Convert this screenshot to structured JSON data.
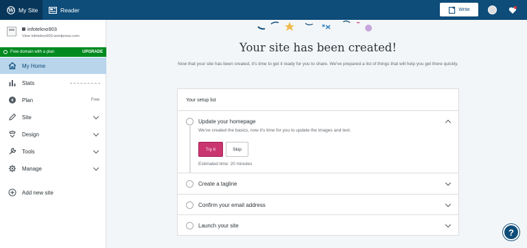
{
  "masterbar": {
    "my_site": "My Site",
    "reader": "Reader",
    "write": "Write"
  },
  "sidebar": {
    "site_name": "infotekno903",
    "site_url": "View infotekno903.wordpress.com",
    "upgrade_text": "Free domain with a plan",
    "upgrade_label": "UPGRADE",
    "items": [
      {
        "label": "My Home",
        "icon": "home-icon"
      },
      {
        "label": "Stats",
        "icon": "stats-icon"
      },
      {
        "label": "Plan",
        "icon": "plan-icon",
        "badge": "Free"
      },
      {
        "label": "Site",
        "icon": "pencil-icon"
      },
      {
        "label": "Design",
        "icon": "design-icon"
      },
      {
        "label": "Tools",
        "icon": "wrench-icon"
      },
      {
        "label": "Manage",
        "icon": "gear-icon"
      }
    ],
    "add_site": "Add new site"
  },
  "main": {
    "title": "Your site has been created!",
    "subtitle": "Now that your site has been created, it's time to get it ready for you to share. We've prepared a list of things that will help you get there quickly.",
    "checklist": {
      "header": "Your setup list",
      "tasks": [
        {
          "title": "Update your homepage",
          "description": "We've created the basics, now it's time for you to update the images and text.",
          "try_label": "Try it",
          "skip_label": "Skip",
          "estimate": "Estimated time: 20 minutes",
          "expanded": true
        },
        {
          "title": "Create a tagline",
          "expanded": false
        },
        {
          "title": "Confirm your email address",
          "expanded": false
        },
        {
          "title": "Launch your site",
          "expanded": false
        }
      ]
    }
  },
  "help": "?",
  "colors": {
    "masterbar": "#0e4c79",
    "active_nav": "#b9d5ec",
    "upgrade": "#008a20",
    "primary_button": "#c9356e"
  }
}
